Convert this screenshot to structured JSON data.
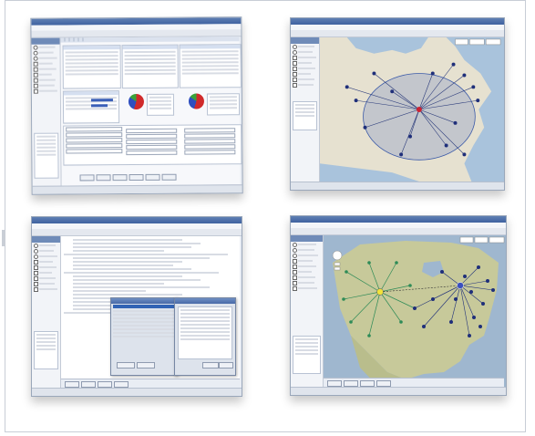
{
  "colors": {
    "window_chrome": "#3f62a0",
    "panel_bg": "#e9edf4",
    "status_red": "#b22222",
    "accent_blue": "#2f4fbf",
    "route_green": "#2e8b57",
    "route_navy": "#1f2f7a"
  },
  "screens": [
    {
      "name": "optimization-settings-window",
      "icon": "form-icon"
    },
    {
      "name": "network-map-window",
      "icon": "map-icon"
    },
    {
      "name": "solution-report-window",
      "icon": "table-icon"
    },
    {
      "name": "us-network-map-window",
      "icon": "map-icon"
    }
  ]
}
